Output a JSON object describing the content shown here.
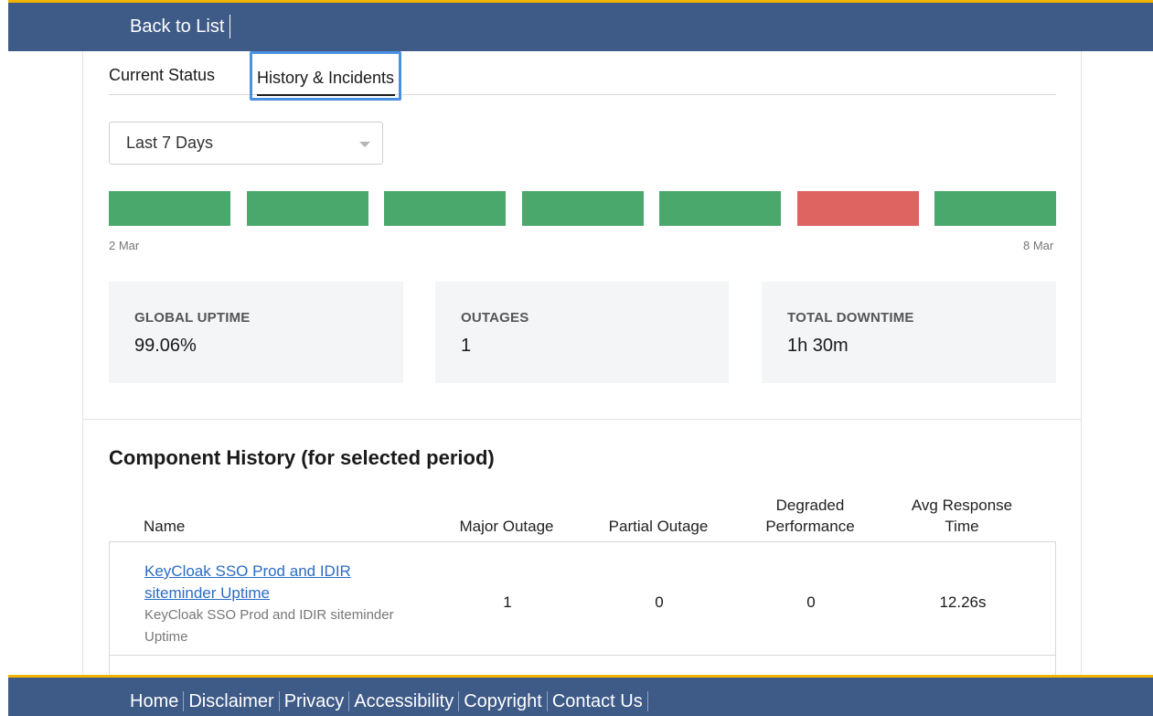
{
  "header": {
    "back_label": "Back to List"
  },
  "tabs": [
    {
      "label": "Current Status",
      "active": false
    },
    {
      "label": "History & Incidents",
      "active": true
    }
  ],
  "period_select": {
    "value": "Last 7 Days"
  },
  "timeline": {
    "start_label": "2 Mar",
    "end_label": "8 Mar",
    "days": [
      {
        "status": "up",
        "color": "#4aa86c"
      },
      {
        "status": "up",
        "color": "#4aa86c"
      },
      {
        "status": "up",
        "color": "#4aa86c"
      },
      {
        "status": "up",
        "color": "#4aa86c"
      },
      {
        "status": "up",
        "color": "#4aa86c"
      },
      {
        "status": "outage",
        "color": "#de6461"
      },
      {
        "status": "up",
        "color": "#4aa86c"
      }
    ]
  },
  "stats": [
    {
      "label": "GLOBAL UPTIME",
      "value": "99.06%"
    },
    {
      "label": "OUTAGES",
      "value": "1"
    },
    {
      "label": "TOTAL DOWNTIME",
      "value": "1h 30m"
    }
  ],
  "component_history": {
    "title": "Component History (for selected period)",
    "columns": {
      "name": "Name",
      "major": "Major Outage",
      "partial": "Partial Outage",
      "degraded_1": "Degraded",
      "degraded_2": "Performance",
      "avg_1": "Avg Response",
      "avg_2": "Time"
    },
    "rows": [
      {
        "name": "KeyCloak SSO Prod and IDIR siteminder Uptime",
        "description": "KeyCloak SSO Prod and IDIR siteminder Uptime",
        "major": "1",
        "partial": "0",
        "degraded": "0",
        "avg_response": "12.26s"
      }
    ]
  },
  "footer": {
    "links": [
      "Home",
      "Disclaimer",
      "Privacy",
      "Accessibility",
      "Copyright",
      "Contact Us"
    ]
  }
}
